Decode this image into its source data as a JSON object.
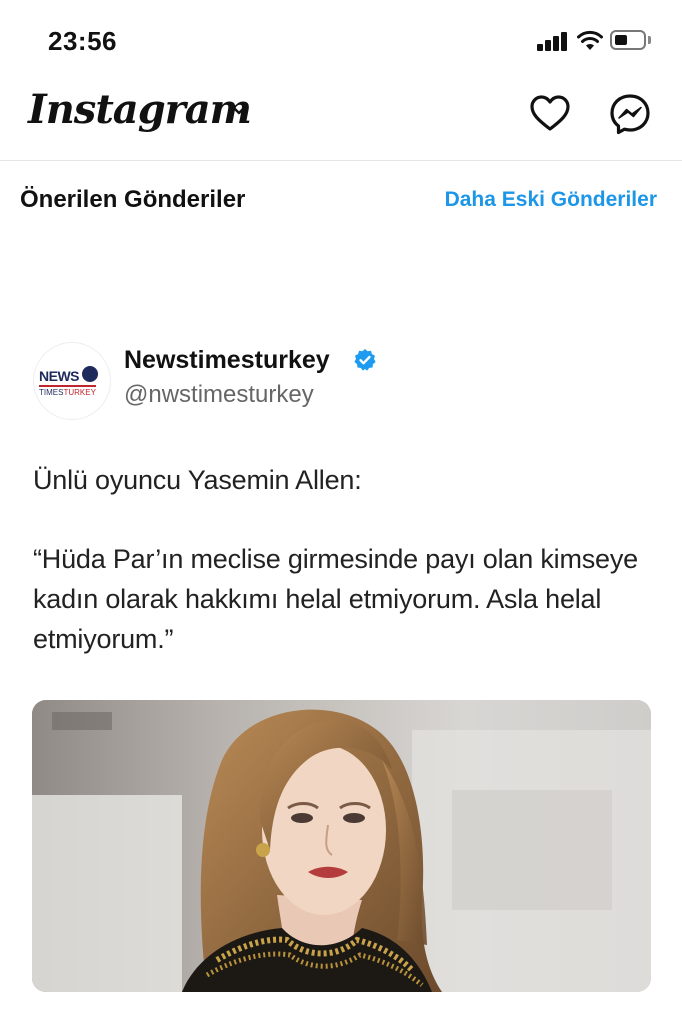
{
  "status_bar": {
    "time": "23:56",
    "icons": [
      "cellular-signal-icon",
      "wifi-icon",
      "battery-icon"
    ],
    "battery_level_percent": 30
  },
  "header": {
    "app_name": "Instagram",
    "icons": [
      "chevron-down-icon",
      "heart-icon",
      "messenger-icon"
    ]
  },
  "feed": {
    "section_title": "Önerilen Gönderiler",
    "older_posts_link": "Daha Eski Gönderiler",
    "link_color": "#1d96e8"
  },
  "post": {
    "author_name": "Newstimesturkey",
    "author_handle": "@nwstimesturkey",
    "verified": true,
    "avatar_logo": {
      "line1": "NEWS",
      "line2": "TIMES",
      "line3": "TURKEY"
    },
    "text_paragraphs": [
      "Ünlü oyuncu Yasemin Allen:",
      "“Hüda Par’ın meclise girmesinde payı olan kimseye kadın olarak hakkımı helal etmiyorum. Asla helal etmiyorum.”"
    ],
    "image": "photo of a woman with long light-brown hair, gold earring and gold-embroidered black top"
  }
}
